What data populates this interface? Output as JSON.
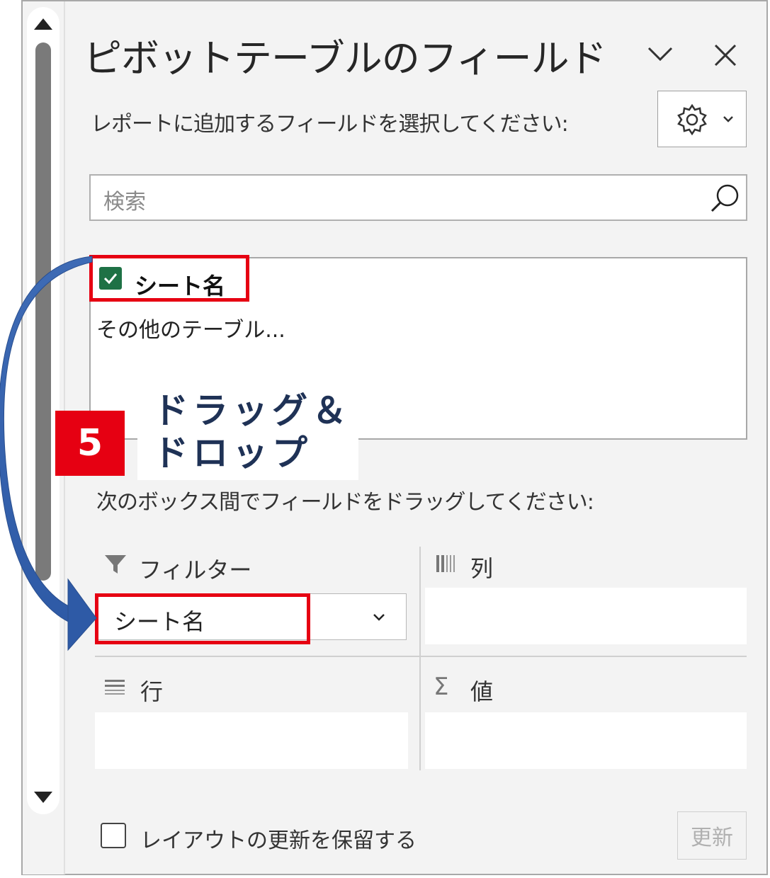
{
  "panel": {
    "title": "ピボットテーブルのフィールド",
    "subtitle": "レポートに追加するフィールドを選択してください:",
    "search_placeholder": "検索"
  },
  "field_list": {
    "items": [
      {
        "label": "シート名",
        "checked": true
      }
    ],
    "more_tables": "その他のテーブル..."
  },
  "annotation": {
    "step_number": "5",
    "callout": "ドラッグ＆\nドロップ",
    "highlight_color": "#e60012",
    "arrow_color": "#3e6bb5"
  },
  "areas": {
    "hint": "次のボックス間でフィールドをドラッグしてください:",
    "filter": {
      "label": "フィルター",
      "items": [
        "シート名"
      ]
    },
    "columns": {
      "label": "列"
    },
    "rows": {
      "label": "行"
    },
    "values": {
      "label": "値",
      "icon": "Σ"
    }
  },
  "footer": {
    "defer_label": "レイアウトの更新を保留する",
    "update_label": "更新"
  },
  "colors": {
    "panel_bg": "#f3f3f3",
    "checkbox_green": "#1e7145",
    "callout_text": "#1f3256"
  }
}
